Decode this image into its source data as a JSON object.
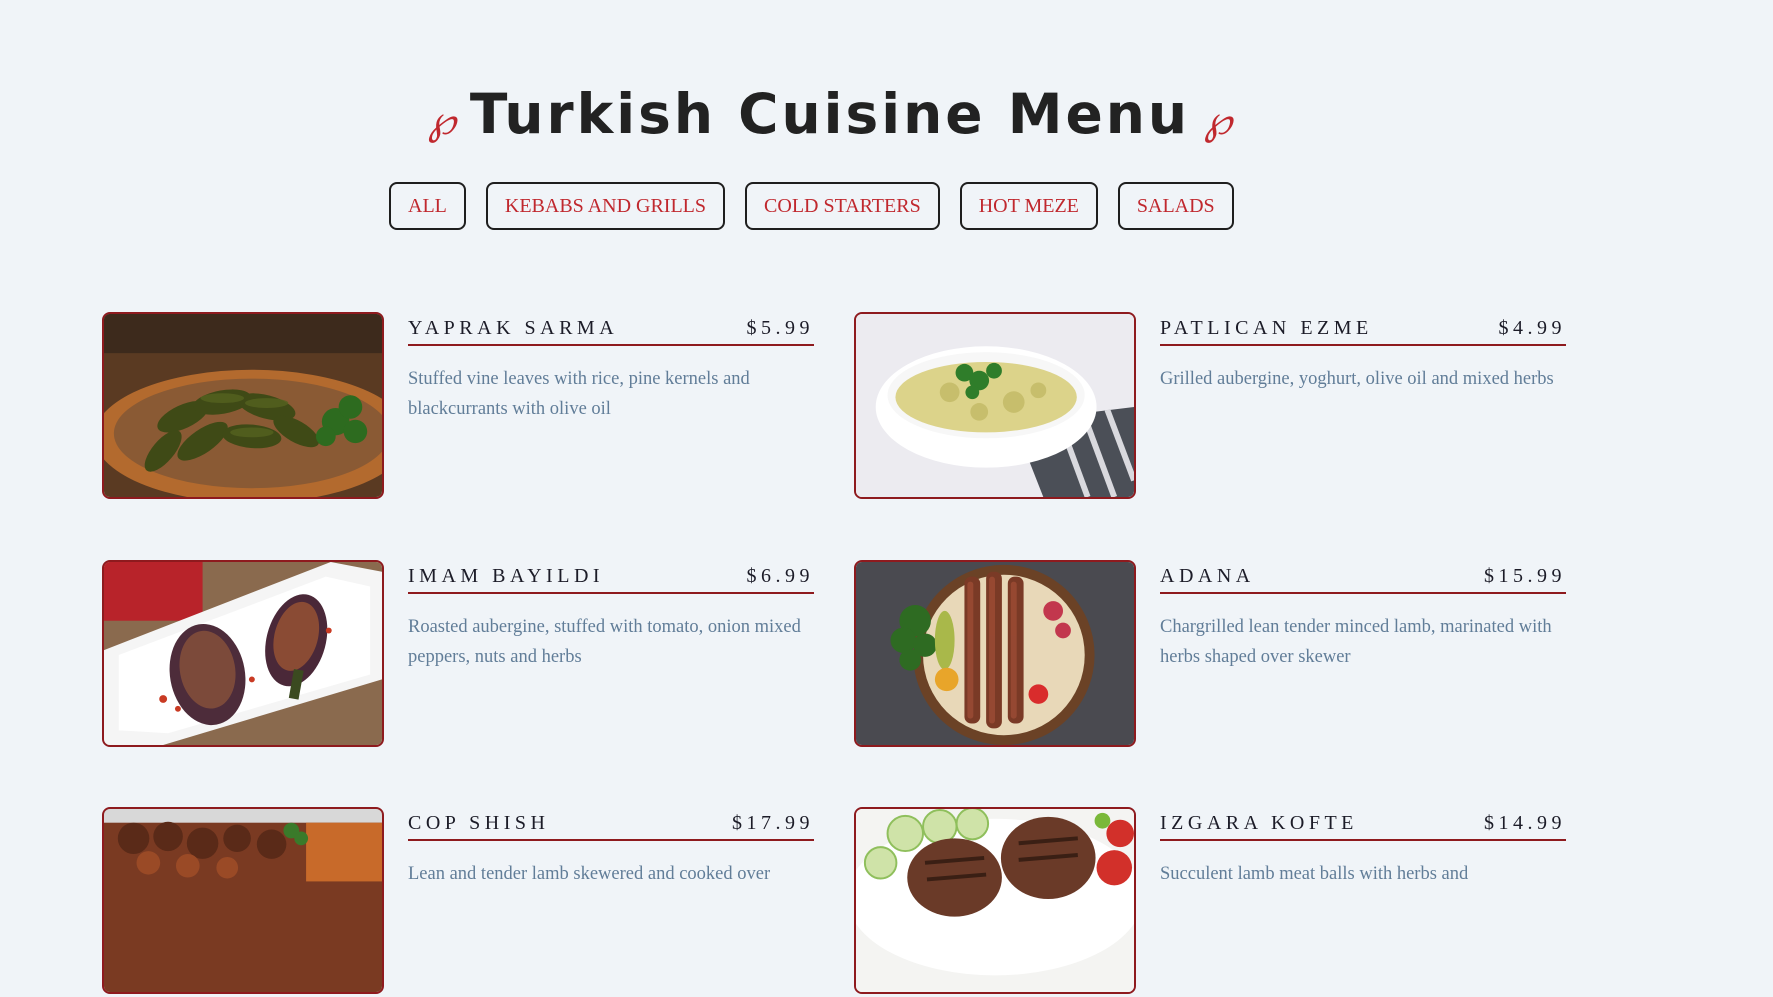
{
  "header": {
    "title": "Turkish Cuisine Menu",
    "flourish_left": "℘",
    "flourish_right": "℘"
  },
  "filters": [
    "ALL",
    "KEBABS AND GRILLS",
    "COLD STARTERS",
    "HOT MEZE",
    "SALADS"
  ],
  "colors": {
    "background": "#f0f4f8",
    "accent": "#c0282e",
    "border": "#8e1a1e",
    "description": "#617d98",
    "title": "#222222"
  },
  "items": [
    {
      "name": "YAPRAK SARMA",
      "price": "$5.99",
      "desc": "Stuffed vine leaves with rice, pine kernels and blackcurrants with olive oil",
      "image": "stuffed-vine-leaves-photo"
    },
    {
      "name": "PATLICAN EZME",
      "price": "$4.99",
      "desc": "Grilled aubergine, yoghurt, olive oil and mixed herbs",
      "image": "aubergine-dip-photo"
    },
    {
      "name": "IMAM BAYILDI",
      "price": "$6.99",
      "desc": "Roasted aubergine, stuffed with tomato, onion mixed peppers, nuts and herbs",
      "image": "stuffed-aubergine-photo"
    },
    {
      "name": "ADANA",
      "price": "$15.99",
      "desc": "Chargrilled lean tender minced lamb, marinated with herbs shaped over skewer",
      "image": "adana-kebab-photo"
    },
    {
      "name": "COP SHISH",
      "price": "$17.99",
      "desc": "Lean and tender lamb skewered and cooked over",
      "image": "cop-shish-photo"
    },
    {
      "name": "IZGARA KOFTE",
      "price": "$14.99",
      "desc": "Succulent lamb meat balls with herbs and",
      "image": "kofte-photo"
    }
  ]
}
